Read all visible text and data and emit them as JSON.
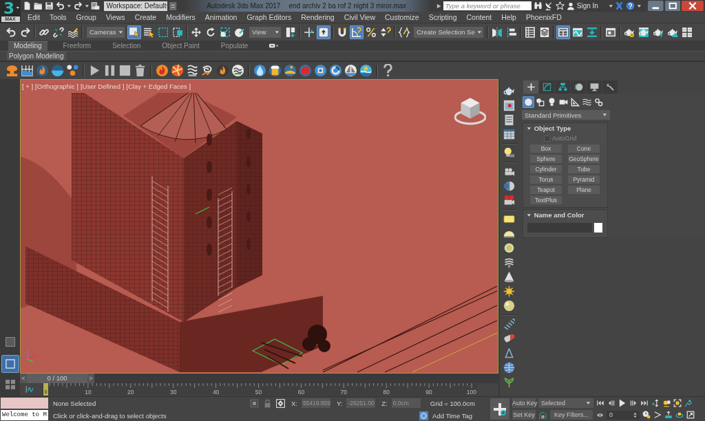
{
  "title_bar": {
    "logo": {
      "numeral": "3",
      "label": "MAX"
    },
    "workspace": "Workspace: Default",
    "app_title": "Autodesk 3ds Max 2017",
    "file_name": "end archiv 2 ba rof 2 night 3 miror.max",
    "search": {
      "placeholder": "Type a keyword or phrase"
    },
    "sign_in": "Sign In"
  },
  "menu_bar": [
    "Edit",
    "Tools",
    "Group",
    "Views",
    "Create",
    "Modifiers",
    "Animation",
    "Graph Editors",
    "Rendering",
    "Civil View",
    "Customize",
    "Scripting",
    "Content",
    "Help",
    "PhoenixFD"
  ],
  "main_toolbar": {
    "dropdowns": [
      "Cameras",
      "View",
      "Create Selection Se"
    ],
    "buttons": [
      {
        "on": false
      },
      {
        "on": false
      },
      {
        "on": false
      },
      {
        "on": false
      },
      {
        "on": false
      },
      {
        "on": true
      },
      {
        "on": false
      },
      {
        "on": false
      },
      {
        "on": false
      },
      {
        "on": false
      },
      {
        "on": false
      },
      {
        "on": false
      },
      {
        "on": false
      },
      {
        "on": false
      },
      {
        "on": false
      },
      {
        "on": true
      },
      {
        "on": false
      },
      {
        "on": true
      },
      {
        "on": false
      },
      {
        "on": false
      },
      {
        "on": false
      },
      {
        "on": false
      },
      {
        "on": false
      },
      {
        "on": false
      },
      {
        "on": false
      },
      {
        "on": true
      },
      {
        "on": false
      },
      {
        "on": false
      },
      {
        "on": false
      },
      {
        "on": false
      },
      {
        "on": false
      },
      {
        "on": false
      },
      {
        "on": false
      },
      {
        "on": false
      }
    ]
  },
  "ribbon": {
    "tabs": [
      {
        "label": "Modeling",
        "selected": true
      },
      {
        "label": "Freeform",
        "selected": false
      },
      {
        "label": "Selection",
        "selected": false
      },
      {
        "label": "Object Paint",
        "selected": false
      },
      {
        "label": "Populate",
        "selected": false
      }
    ],
    "panel": "Polygon Modeling"
  },
  "viewport": {
    "labels": [
      "[ + ]",
      "[Orthographic ]",
      "[User Defined ]",
      "[Clay + Edged Faces ]"
    ]
  },
  "viewport_layouts": [
    {
      "selected": true
    },
    {
      "selected": false
    }
  ],
  "command_panel": {
    "tabs": [
      {
        "selected": true
      },
      {
        "selected": false
      },
      {
        "selected": false
      },
      {
        "selected": false
      },
      {
        "selected": false
      },
      {
        "selected": false
      }
    ],
    "categories": [
      {
        "selected": true
      },
      {
        "selected": false
      },
      {
        "selected": false
      },
      {
        "selected": false
      },
      {
        "selected": false
      },
      {
        "selected": false
      },
      {
        "selected": false
      }
    ],
    "dropdown": "Standard Primitives",
    "object_type": {
      "title": "Object Type",
      "autogrid": {
        "label": "AutoGrid",
        "checked": false,
        "disabled": true
      },
      "buttons": [
        "Box",
        "Cone",
        "Sphere",
        "GeoSphere",
        "Cylinder",
        "Tube",
        "Torus",
        "Pyramid",
        "Teapot",
        "Plane",
        "TextPlus"
      ]
    },
    "name_and_color": {
      "title": "Name and Color"
    }
  },
  "time_slider": {
    "previous": "<",
    "value": "0 / 100",
    "next": ">",
    "level": 0
  },
  "track_bar": {
    "current_frame": "0",
    "ticks": [
      "10",
      "20",
      "30",
      "40",
      "50",
      "60",
      "70",
      "80",
      "90",
      "100"
    ]
  },
  "status_bar": {
    "listener_output": "Welcome to M",
    "selection": "None Selected",
    "prompt": "Click or click-and-drag to select objects",
    "coordinates": [
      {
        "label": "X:",
        "value": "55419.859"
      },
      {
        "label": "Y:",
        "value": "-26251.00"
      },
      {
        "label": "Z:",
        "value": "0.0cm"
      }
    ],
    "grid": "Grid = 100.0cm",
    "time_tag": "Add Time Tag"
  },
  "animation_controls": {
    "auto_key": "Auto Key",
    "key_set": "Selected",
    "set_key": "Set Key",
    "key_filters": "Key Filters...",
    "frame": "0"
  }
}
